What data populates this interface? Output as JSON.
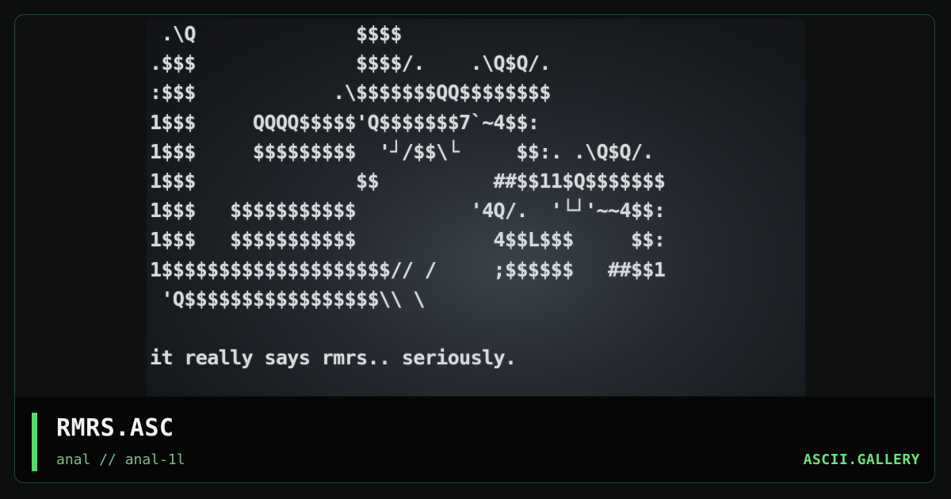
{
  "preview": {
    "art_lines": [
      " .\\Q              $$$$",
      ".$$$              $$$$/.    .\\Q$Q/.",
      ":$$$            .\\$$$$$$$QQ$$$$$$$$",
      "1$$$     QQQQ$$$$$'Q$$$$$$$7`~4$$:",
      "1$$$     $$$$$$$$$  '┘/$$\\└     $$:. .\\Q$Q/.",
      "1$$$              $$          ##$$11$Q$$$$$$$",
      "1$$$   $$$$$$$$$$$          '4Q/.  '└┘'~~4$$:",
      "1$$$   $$$$$$$$$$$            4$$L$$$     $$:",
      "1$$$$$$$$$$$$$$$$$$$$// /     ;$$$$$$   ##$$1",
      " 'Q$$$$$$$$$$$$$$$$$\\\\ \\",
      "",
      "it really says rmrs.. seriously."
    ]
  },
  "footer": {
    "title": "RMRS.ASC",
    "subtitle": "anal // anal-1l",
    "brand": "ASCII.GALLERY"
  },
  "colors": {
    "accent": "#59d870",
    "brand": "#6be37f",
    "subtitle": "#84b98c",
    "frame_border": "#2a4a30"
  }
}
